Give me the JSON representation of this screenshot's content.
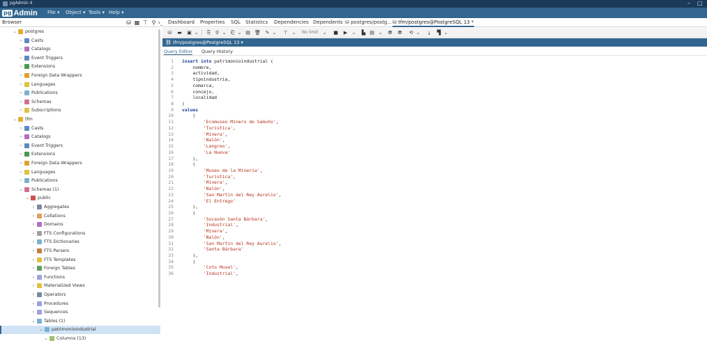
{
  "window": {
    "title": "pgAdmin 4",
    "minimize": "–",
    "maximize": "□"
  },
  "menubar": {
    "logo_pg": "pg",
    "logo_admin": "Admin",
    "items": [
      "File ▾",
      "Object ▾",
      "Tools ▾",
      "Help ▾"
    ]
  },
  "browser": {
    "label": "Browser"
  },
  "tabs": [
    {
      "label": "Dashboard"
    },
    {
      "label": "Properties"
    },
    {
      "label": "SQL"
    },
    {
      "label": "Statistics"
    },
    {
      "label": "Dependencies"
    },
    {
      "label": "Dependents"
    },
    {
      "label": "postgres/postg..."
    },
    {
      "label": "tfm/postgres@PostgreSQL 13 *"
    }
  ],
  "tree": [
    {
      "label": "postgres",
      "indent": 1,
      "expanded": true,
      "icon": "database-icon",
      "color": "#e0b030"
    },
    {
      "label": "Casts",
      "indent": 2,
      "expanded": false,
      "icon": "casts-icon",
      "color": "#5a8ac0"
    },
    {
      "label": "Catalogs",
      "indent": 2,
      "expanded": false,
      "icon": "catalogs-icon",
      "color": "#b070c0"
    },
    {
      "label": "Event Triggers",
      "indent": 2,
      "expanded": false,
      "icon": "event-trigger-icon",
      "color": "#5a8ac0"
    },
    {
      "label": "Extensions",
      "indent": 2,
      "expanded": false,
      "icon": "extensions-icon",
      "color": "#4a9a50"
    },
    {
      "label": "Foreign Data Wrappers",
      "indent": 2,
      "expanded": false,
      "icon": "fdw-icon",
      "color": "#e0a030"
    },
    {
      "label": "Languages",
      "indent": 2,
      "expanded": false,
      "icon": "languages-icon",
      "color": "#e0c040"
    },
    {
      "label": "Publications",
      "indent": 2,
      "expanded": false,
      "icon": "publications-icon",
      "color": "#7ab0d0"
    },
    {
      "label": "Schemas",
      "indent": 2,
      "expanded": false,
      "icon": "schemas-icon",
      "color": "#d07090"
    },
    {
      "label": "Subscriptions",
      "indent": 2,
      "expanded": false,
      "icon": "subscriptions-icon",
      "color": "#e0c040"
    },
    {
      "label": "tfm",
      "indent": 1,
      "expanded": true,
      "icon": "database-icon",
      "color": "#e0b030"
    },
    {
      "label": "Casts",
      "indent": 2,
      "expanded": false,
      "icon": "casts-icon",
      "color": "#5a8ac0"
    },
    {
      "label": "Catalogs",
      "indent": 2,
      "expanded": false,
      "icon": "catalogs-icon",
      "color": "#b070c0"
    },
    {
      "label": "Event Triggers",
      "indent": 2,
      "expanded": false,
      "icon": "event-trigger-icon",
      "color": "#5a8ac0"
    },
    {
      "label": "Extensions",
      "indent": 2,
      "expanded": false,
      "icon": "extensions-icon",
      "color": "#4a9a50"
    },
    {
      "label": "Foreign Data Wrappers",
      "indent": 2,
      "expanded": false,
      "icon": "fdw-icon",
      "color": "#e0a030"
    },
    {
      "label": "Languages",
      "indent": 2,
      "expanded": false,
      "icon": "languages-icon",
      "color": "#e0c040"
    },
    {
      "label": "Publications",
      "indent": 2,
      "expanded": false,
      "icon": "publications-icon",
      "color": "#7ab0d0"
    },
    {
      "label": "Schemas (1)",
      "indent": 2,
      "expanded": true,
      "icon": "schemas-icon",
      "color": "#d07090"
    },
    {
      "label": "public",
      "indent": 3,
      "expanded": true,
      "icon": "schema-icon",
      "color": "#d05050"
    },
    {
      "label": "Aggregates",
      "indent": 4,
      "expanded": false,
      "icon": "aggregates-icon",
      "color": "#7a8aa0"
    },
    {
      "label": "Collations",
      "indent": 4,
      "expanded": false,
      "icon": "collations-icon",
      "color": "#e0a060"
    },
    {
      "label": "Domains",
      "indent": 4,
      "expanded": false,
      "icon": "domains-icon",
      "color": "#b070c0"
    },
    {
      "label": "FTS Configurations",
      "indent": 4,
      "expanded": false,
      "icon": "fts-config-icon",
      "color": "#a0a0a0"
    },
    {
      "label": "FTS Dictionaries",
      "indent": 4,
      "expanded": false,
      "icon": "fts-dict-icon",
      "color": "#7ab0d0"
    },
    {
      "label": "FTS Parsers",
      "indent": 4,
      "expanded": false,
      "icon": "fts-parser-icon",
      "color": "#c08040"
    },
    {
      "label": "FTS Templates",
      "indent": 4,
      "expanded": false,
      "icon": "fts-template-icon",
      "color": "#e0c040"
    },
    {
      "label": "Foreign Tables",
      "indent": 4,
      "expanded": false,
      "icon": "foreign-table-icon",
      "color": "#60a060"
    },
    {
      "label": "Functions",
      "indent": 4,
      "expanded": false,
      "icon": "functions-icon",
      "color": "#a0a0e0"
    },
    {
      "label": "Materialized Views",
      "indent": 4,
      "expanded": false,
      "icon": "mat-view-icon",
      "color": "#e0c040"
    },
    {
      "label": "Operators",
      "indent": 4,
      "expanded": false,
      "icon": "operators-icon",
      "color": "#7a8aa0"
    },
    {
      "label": "Procedures",
      "indent": 4,
      "expanded": false,
      "icon": "procedures-icon",
      "color": "#a0a0e0"
    },
    {
      "label": "Sequences",
      "indent": 4,
      "expanded": false,
      "icon": "sequences-icon",
      "color": "#a0a0e0"
    },
    {
      "label": "Tables (1)",
      "indent": 4,
      "expanded": true,
      "icon": "tables-icon",
      "color": "#7ab0d0"
    },
    {
      "label": "patrimonioindustrial",
      "indent": 5,
      "expanded": true,
      "icon": "table-icon",
      "color": "#7ab0d0",
      "selected": true
    },
    {
      "label": "Columns (13)",
      "indent": 6,
      "expanded": true,
      "icon": "columns-icon",
      "color": "#a0c070"
    }
  ],
  "toolbar": {
    "nolimit": "No limit"
  },
  "connection": {
    "label": "tfm/postgres@PostgreSQL 13 ▾"
  },
  "editor_tabs": {
    "query_editor": "Query Editor",
    "query_history": "Query History"
  },
  "code_lines": [
    [
      {
        "t": "insert into",
        "k": "kw"
      },
      {
        "t": " patrimonioindustrial (",
        "k": ""
      }
    ],
    [
      {
        "t": "    nombre,",
        "k": ""
      }
    ],
    [
      {
        "t": "    actividad,",
        "k": ""
      }
    ],
    [
      {
        "t": "    tipoindustria,",
        "k": ""
      }
    ],
    [
      {
        "t": "    comarca,",
        "k": ""
      }
    ],
    [
      {
        "t": "    concejo,",
        "k": ""
      }
    ],
    [
      {
        "t": "    localidad",
        "k": ""
      }
    ],
    [
      {
        "t": ")",
        "k": ""
      }
    ],
    [
      {
        "t": "values",
        "k": "kw"
      }
    ],
    [
      {
        "t": "    (",
        "k": ""
      }
    ],
    [
      {
        "t": "        ",
        "k": ""
      },
      {
        "t": "'Ecomuseo Minero de Samuño'",
        "k": "str"
      },
      {
        "t": ",",
        "k": ""
      }
    ],
    [
      {
        "t": "        ",
        "k": ""
      },
      {
        "t": "'Turistica'",
        "k": "str"
      },
      {
        "t": ",",
        "k": ""
      }
    ],
    [
      {
        "t": "        ",
        "k": ""
      },
      {
        "t": "'Minera'",
        "k": "str"
      },
      {
        "t": ",",
        "k": ""
      }
    ],
    [
      {
        "t": "        ",
        "k": ""
      },
      {
        "t": "'Nalón'",
        "k": "str"
      },
      {
        "t": ",",
        "k": ""
      }
    ],
    [
      {
        "t": "        ",
        "k": ""
      },
      {
        "t": "'Langreo'",
        "k": "str"
      },
      {
        "t": ",",
        "k": ""
      }
    ],
    [
      {
        "t": "        ",
        "k": ""
      },
      {
        "t": "'La Nueva'",
        "k": "str"
      }
    ],
    [
      {
        "t": "    ),",
        "k": ""
      }
    ],
    [
      {
        "t": "    (",
        "k": ""
      }
    ],
    [
      {
        "t": "        ",
        "k": ""
      },
      {
        "t": "'Museo de la Mineria'",
        "k": "str"
      },
      {
        "t": ",",
        "k": ""
      }
    ],
    [
      {
        "t": "        ",
        "k": ""
      },
      {
        "t": "'Turistica'",
        "k": "str"
      },
      {
        "t": ",",
        "k": ""
      }
    ],
    [
      {
        "t": "        ",
        "k": ""
      },
      {
        "t": "'Minera'",
        "k": "str"
      },
      {
        "t": ",",
        "k": ""
      }
    ],
    [
      {
        "t": "        ",
        "k": ""
      },
      {
        "t": "'Nalón'",
        "k": "str"
      },
      {
        "t": ",",
        "k": ""
      }
    ],
    [
      {
        "t": "        ",
        "k": ""
      },
      {
        "t": "'San Martin del Rey Aurelio'",
        "k": "str"
      },
      {
        "t": ",",
        "k": ""
      }
    ],
    [
      {
        "t": "        ",
        "k": ""
      },
      {
        "t": "'El Entrego'",
        "k": "str"
      }
    ],
    [
      {
        "t": "    ),",
        "k": ""
      }
    ],
    [
      {
        "t": "    (",
        "k": ""
      }
    ],
    [
      {
        "t": "        ",
        "k": ""
      },
      {
        "t": "'Socavón Santa Bárbara'",
        "k": "str"
      },
      {
        "t": ",",
        "k": ""
      }
    ],
    [
      {
        "t": "        ",
        "k": ""
      },
      {
        "t": "'Industrial'",
        "k": "str"
      },
      {
        "t": ",",
        "k": ""
      }
    ],
    [
      {
        "t": "        ",
        "k": ""
      },
      {
        "t": "'Minera'",
        "k": "str"
      },
      {
        "t": ",",
        "k": ""
      }
    ],
    [
      {
        "t": "        ",
        "k": ""
      },
      {
        "t": "'Nalón'",
        "k": "str"
      },
      {
        "t": ",",
        "k": ""
      }
    ],
    [
      {
        "t": "        ",
        "k": ""
      },
      {
        "t": "'San Martin del Rey Aurelio'",
        "k": "str"
      },
      {
        "t": ",",
        "k": ""
      }
    ],
    [
      {
        "t": "        ",
        "k": ""
      },
      {
        "t": "'Santa Bárbara'",
        "k": "str"
      }
    ],
    [
      {
        "t": "    ),",
        "k": ""
      }
    ],
    [
      {
        "t": "    (",
        "k": ""
      }
    ],
    [
      {
        "t": "        ",
        "k": ""
      },
      {
        "t": "'Coto Musel'",
        "k": "str"
      },
      {
        "t": ",",
        "k": ""
      }
    ],
    [
      {
        "t": "        ",
        "k": ""
      },
      {
        "t": "'Industrial'",
        "k": "str"
      },
      {
        "t": ",",
        "k": ""
      }
    ]
  ]
}
